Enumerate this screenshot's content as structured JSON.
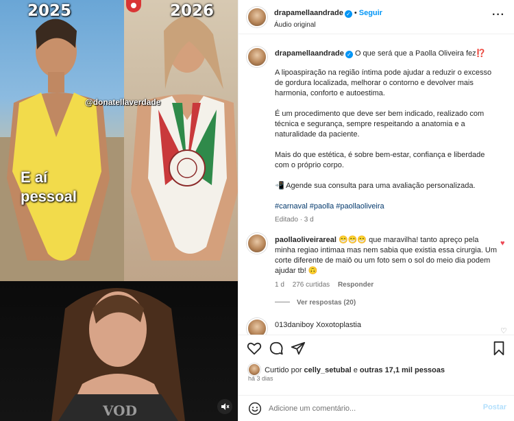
{
  "media": {
    "year_left": "2025",
    "year_right": "2026",
    "watermark": "@donatellaverdade",
    "caption_line1": "E aí",
    "caption_line2": "pessoal",
    "mute_icon": "speaker-muted-icon"
  },
  "header": {
    "username": "drapamellaandrade",
    "follow_label": "Seguir",
    "audio": "Áudio original"
  },
  "post_caption": {
    "username": "drapamellaandrade",
    "headline": "O que será que a Paolla Oliveira fez⁉️",
    "paragraph1": "A lipoaspiração na região íntima pode ajudar a reduzir o excesso de gordura localizada, melhorar o contorno e devolver mais harmonia, conforto e autoestima.",
    "paragraph2": "É um procedimento que deve ser bem indicado, realizado com técnica e segurança, sempre respeitando a anatomia e a naturalidade da paciente.",
    "paragraph3": "Mais do que estética, é sobre bem-estar, confiança e liberdade com o próprio corpo.",
    "paragraph4": "📲 Agende sua consulta para uma avaliação personalizada.",
    "hashtags": "#carnaval #paolla #paollaoliveira",
    "edited": "Editado · 3 d"
  },
  "comment1": {
    "username": "paollaoliveirareal",
    "text": "😁😁😁 que maravilha! tanto apreço pela minha regiao intimaa mas nem sabia que existia essa cirurgia. Um corte diferente de maiô ou um foto sem o sol do meio dia podem ajudar tb! 🙃",
    "age": "1 d",
    "likes": "276 curtidas",
    "reply": "Responder",
    "view_replies": "Ver respostas (20)"
  },
  "comment2": {
    "username": "013daniboy",
    "text": "Xoxotoplastia"
  },
  "actions": {
    "liked_prefix": "Curtido por",
    "liked_user": "celly_setubal",
    "liked_connector": "e",
    "liked_others": "outras 17,1 mil pessoas",
    "date": "há 3 dias"
  },
  "add_comment": {
    "placeholder": "Adicione um comentário...",
    "post_label": "Postar"
  },
  "colors": {
    "accent": "#0095f6",
    "heart": "#ed4956",
    "hashtag": "#00376b",
    "muted_text": "#737373"
  }
}
